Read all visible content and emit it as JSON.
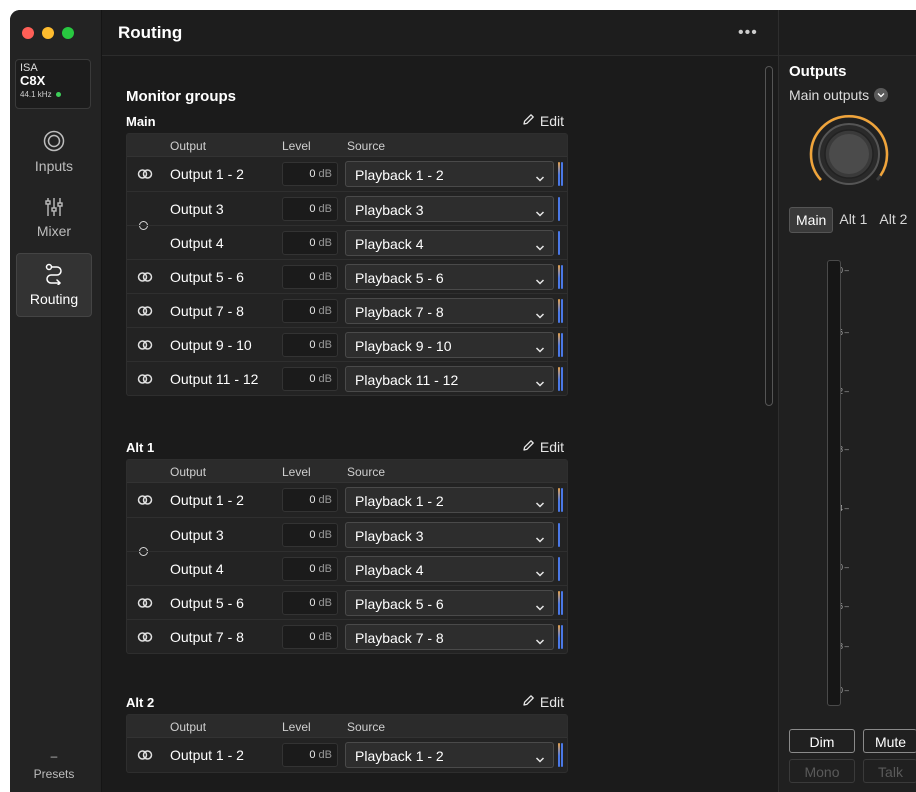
{
  "app": {
    "page_title": "Routing",
    "more_icon": "ellipsis-icon",
    "traffic_colors": [
      "#ff5f57",
      "#febc2e",
      "#28c840"
    ]
  },
  "device": {
    "brand": "ISA",
    "model": "C8X",
    "sample_rate": "44.1 kHz",
    "status_color": "#3ecf5a"
  },
  "nav": {
    "items": [
      {
        "label": "Inputs",
        "icon": "input-ring-icon"
      },
      {
        "label": "Mixer",
        "icon": "mixer-sliders-icon"
      },
      {
        "label": "Routing",
        "icon": "routing-icon"
      }
    ],
    "active": "Routing",
    "presets_dash": "–",
    "presets_label": "Presets"
  },
  "main": {
    "section_title": "Monitor groups",
    "edit_label": "Edit",
    "columns": {
      "output": "Output",
      "level": "Level",
      "source": "Source"
    },
    "groups": [
      {
        "name": "Main",
        "rows": [
          {
            "output": "Output 1 - 2",
            "level": "0",
            "source": "Playback 1 - 2"
          },
          {
            "output": "Output 3",
            "level": "0",
            "source": "Playback 3"
          },
          {
            "output": "Output 4",
            "level": "0",
            "source": "Playback 4"
          },
          {
            "output": "Output 5 - 6",
            "level": "0",
            "source": "Playback 5 - 6"
          },
          {
            "output": "Output 7 - 8",
            "level": "0",
            "source": "Playback 7 - 8"
          },
          {
            "output": "Output 9 - 10",
            "level": "0",
            "source": "Playback 9 - 10"
          },
          {
            "output": "Output 11 - 12",
            "level": "0",
            "source": "Playback 11 - 12"
          }
        ]
      },
      {
        "name": "Alt 1",
        "rows": [
          {
            "output": "Output 1 - 2",
            "level": "0",
            "source": "Playback 1 - 2"
          },
          {
            "output": "Output 3",
            "level": "0",
            "source": "Playback 3"
          },
          {
            "output": "Output 4",
            "level": "0",
            "source": "Playback 4"
          },
          {
            "output": "Output 5 - 6",
            "level": "0",
            "source": "Playback 5 - 6"
          },
          {
            "output": "Output 7 - 8",
            "level": "0",
            "source": "Playback 7 - 8"
          }
        ]
      },
      {
        "name": "Alt 2",
        "rows": [
          {
            "output": "Output 1 - 2",
            "level": "0",
            "source": "Playback 1 - 2"
          }
        ]
      }
    ],
    "level_unit": "dB"
  },
  "outputs": {
    "title": "Outputs",
    "selector": "Main outputs",
    "tabs": [
      "Main",
      "Alt 1",
      "Alt 2"
    ],
    "active_tab": "Main",
    "scale": [
      "0",
      "6",
      "12",
      "18",
      "24",
      "30",
      "36",
      "48",
      "60"
    ],
    "buttons": {
      "dim": "Dim",
      "mute": "Mute",
      "mono": "Mono",
      "talk": "Talk"
    },
    "knob_ring_color": "#f0a43a"
  }
}
